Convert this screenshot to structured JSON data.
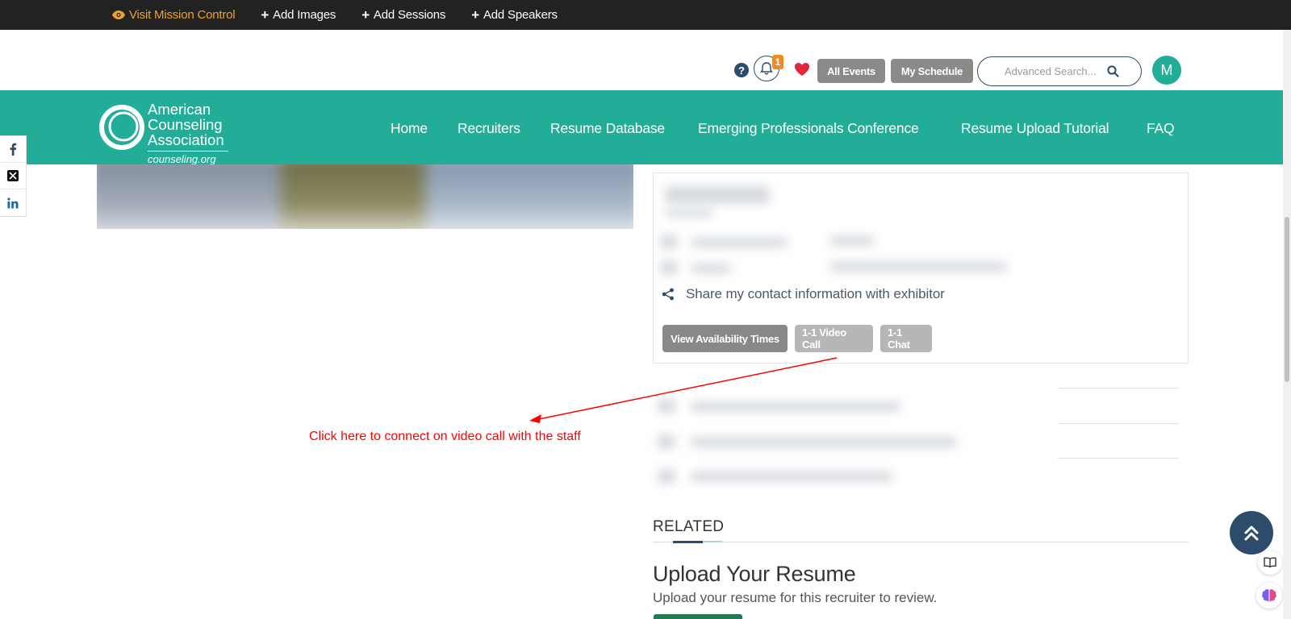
{
  "admin_bar": {
    "mission_control": "Visit Mission Control",
    "add_images": "Add Images",
    "add_sessions": "Add Sessions",
    "add_speakers": "Add Speakers"
  },
  "utility": {
    "help": "?",
    "notification_count": "1",
    "all_events": "All Events",
    "my_schedule": "My Schedule",
    "search_placeholder": "Advanced Search...",
    "avatar_initial": "M"
  },
  "logo": {
    "line1": "American",
    "line2": "Counseling",
    "line3": "Association",
    "url": "counseling.org"
  },
  "nav": {
    "items": [
      "Home",
      "Recruiters",
      "Resume Database",
      "Emerging Professionals Conference",
      "Resume Upload Tutorial",
      "FAQ"
    ]
  },
  "contact_card": {
    "share_text": "Share my contact information with exhibitor",
    "view_availability": "View Availability Times",
    "video_call": "1-1 Video Call",
    "chat": "1-1 Chat"
  },
  "annotation": {
    "text": "Click here to connect on video call with the staff"
  },
  "related": {
    "heading": "RELATED",
    "upload_title": "Upload Your Resume",
    "upload_desc": "Upload your resume for this recruiter to review."
  },
  "colors": {
    "teal": "#22ad98",
    "navy": "#2d4b6a",
    "admin_bg": "#222222",
    "orange": "#f0a030",
    "annotation_red": "#ff0000"
  }
}
